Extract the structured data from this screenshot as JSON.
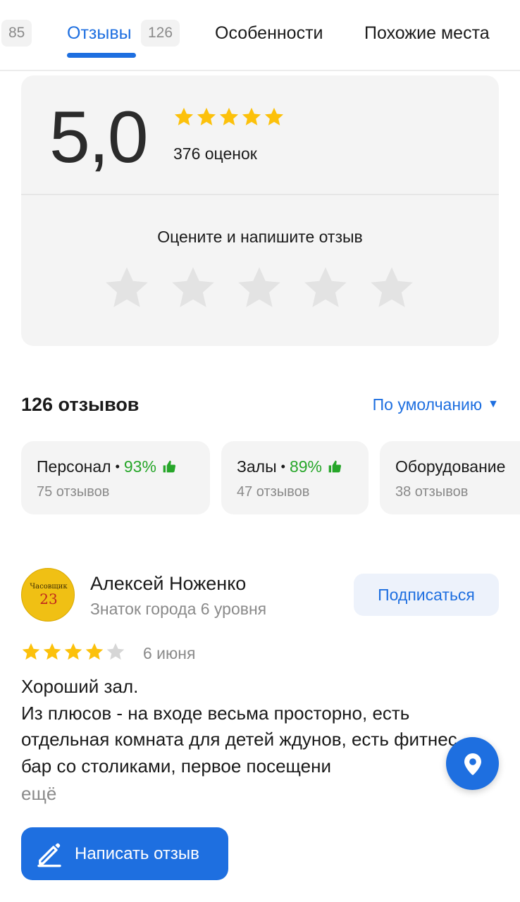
{
  "tabs": {
    "prev_badge": "85",
    "reviews_label": "Отзывы",
    "reviews_badge": "126",
    "features_label": "Особенности",
    "similar_label": "Похожие места"
  },
  "rating": {
    "score": "5,0",
    "stars_filled": 5,
    "count_label": "376 оценок",
    "rate_prompt": "Оцените и напишите отзыв"
  },
  "reviews_header": {
    "count_label": "126 отзывов",
    "sort_label": "По умолчанию"
  },
  "aspects": [
    {
      "name": "Персонал",
      "percent": "93%",
      "reviews": "75 отзывов"
    },
    {
      "name": "Залы",
      "percent": "89%",
      "reviews": "47 отзывов"
    },
    {
      "name": "Оборудование",
      "percent": "",
      "reviews": "38 отзывов"
    }
  ],
  "review": {
    "avatar_line1": "Часовщик",
    "avatar_line2": "23",
    "author": "Алексей Ноженко",
    "level": "Знаток города 6 уровня",
    "subscribe_label": "Подписаться",
    "stars": 4,
    "date": "6 июня",
    "text": "Хороший зал.\nИз плюсов - на входе весьма просторно, есть отдельная комната для детей ждунов, есть фитнес бар со столиками, первое посещени",
    "more_label": "ещё"
  },
  "write_button_label": "Написать отзыв",
  "colors": {
    "accent": "#1e6fe0",
    "star": "#fcc10b",
    "positive": "#26a629"
  }
}
